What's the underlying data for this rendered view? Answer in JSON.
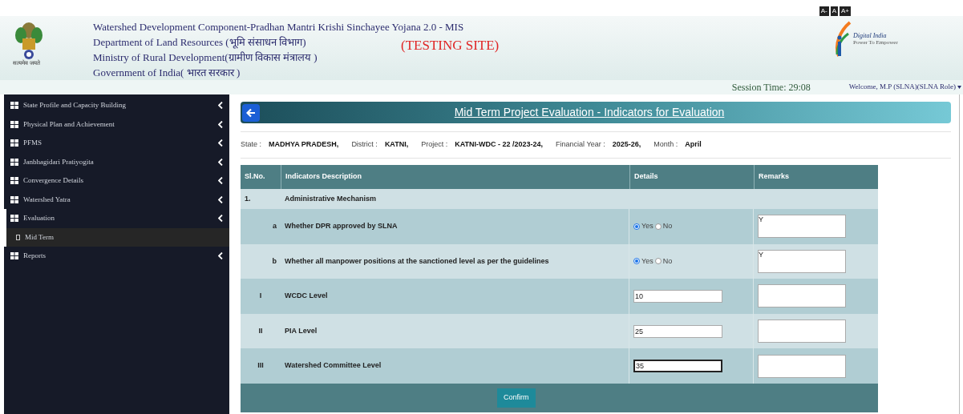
{
  "font_size_buttons": [
    "A-",
    "A",
    "A+"
  ],
  "header": {
    "lines": [
      "Watershed Development Component-Pradhan Mantri Krishi Sinchayee Yojana 2.0 - MIS",
      "Department of Land Resources (भूमि संसाधन विभाग)",
      "Ministry of Rural Development(ग्रामीण विकास मंत्रालय )",
      "Government of India( भारत सरकार )"
    ],
    "emblem_caption": "सत्यमेव जयते",
    "testing_label": "(TESTING SITE)",
    "logo_text": "Digital India",
    "logo_tagline": "Power To Empower"
  },
  "session_time": "Session Time: 29:08",
  "welcome": "Welcome, M.P (SLNA)(SLNA Role)",
  "sidebar": {
    "items": [
      {
        "label": "State Profile and Capacity Building",
        "expanded": false
      },
      {
        "label": "Physical Plan and Achievement",
        "expanded": false
      },
      {
        "label": "PFMS",
        "expanded": false
      },
      {
        "label": "Janbhagidari Pratiyogita",
        "expanded": false
      },
      {
        "label": "Convergence Details",
        "expanded": false
      },
      {
        "label": "Watershed Yatra",
        "expanded": false
      },
      {
        "label": "Evaluation",
        "expanded": true,
        "children": [
          {
            "label": "Mid Term",
            "selected": true
          }
        ]
      },
      {
        "label": "Reports",
        "expanded": false
      }
    ]
  },
  "page_title": "Mid Term Project Evaluation - Indicators for Evaluation",
  "info": [
    {
      "label": "State :",
      "value": "MADHYA PRADESH,"
    },
    {
      "label": "District :",
      "value": "KATNI,"
    },
    {
      "label": "Project :",
      "value": "KATNI-WDC - 22 /2023-24,"
    },
    {
      "label": "Financial Year :",
      "value": "2025-26,"
    },
    {
      "label": "Month :",
      "value": "April"
    }
  ],
  "table": {
    "columns": [
      "Sl.No.",
      "Indicators Description",
      "Details",
      "Remarks"
    ],
    "rows": [
      {
        "kind": "section",
        "no": "1.",
        "description": "Administrative Mechanism"
      },
      {
        "kind": "radio",
        "no": "a",
        "description": "Whether DPR approved by SLNA",
        "options": [
          {
            "label": "Yes",
            "selected": true
          },
          {
            "label": "No",
            "selected": false
          }
        ],
        "remarks": "Y"
      },
      {
        "kind": "radio",
        "no": "b",
        "description": "Whether all manpower positions at the sanctioned level as per the guidelines",
        "options": [
          {
            "label": "Yes",
            "selected": true
          },
          {
            "label": "No",
            "selected": false
          }
        ],
        "remarks": "Y"
      },
      {
        "kind": "number",
        "no": "I",
        "description": "WCDC Level",
        "value": "10",
        "focused": false
      },
      {
        "kind": "number",
        "no": "II",
        "description": "PIA Level",
        "value": "25",
        "focused": false
      },
      {
        "kind": "number",
        "no": "III",
        "description": "Watershed Committee Level",
        "value": "35",
        "focused": true
      }
    ],
    "confirm": "Confirm"
  }
}
